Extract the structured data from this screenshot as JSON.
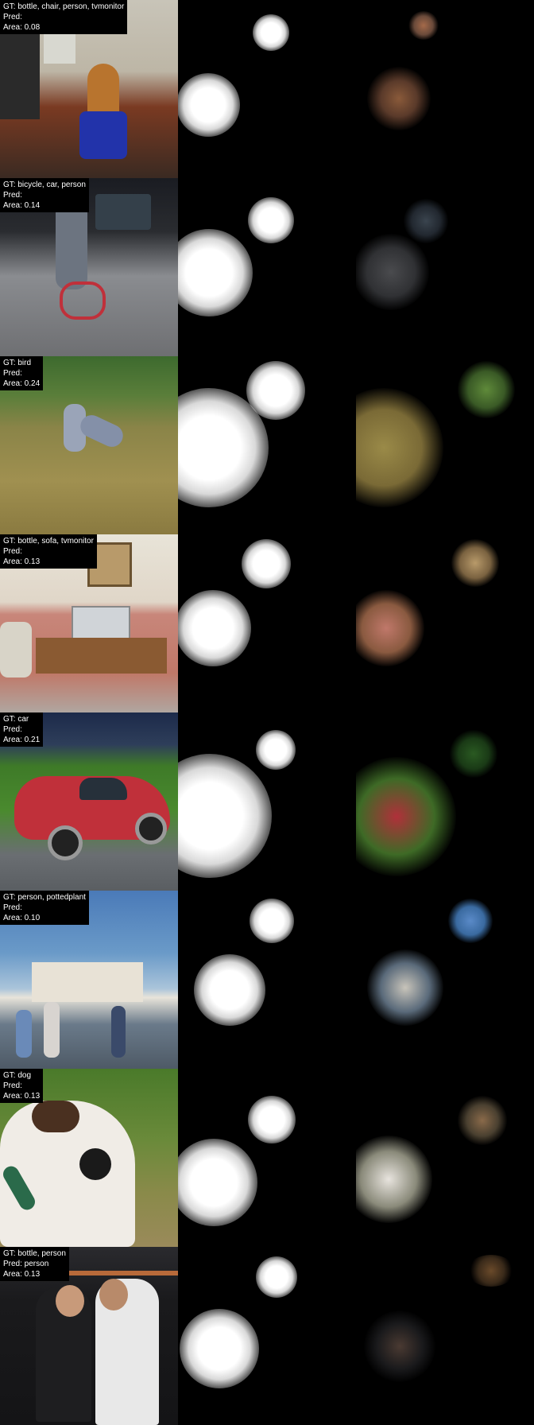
{
  "rows": [
    {
      "gt": "GT: bottle, chair, person, tvmonitor",
      "pred": "Pred:",
      "area": "Area: 0.08"
    },
    {
      "gt": "GT: bicycle, car, person",
      "pred": "Pred:",
      "area": "Area: 0.14"
    },
    {
      "gt": "GT: bird",
      "pred": "Pred:",
      "area": "Area: 0.24"
    },
    {
      "gt": "GT: bottle, sofa, tvmonitor",
      "pred": "Pred:",
      "area": "Area: 0.13"
    },
    {
      "gt": "GT: car",
      "pred": "Pred:",
      "area": "Area: 0.21"
    },
    {
      "gt": "GT: person, pottedplant",
      "pred": "Pred:",
      "area": "Area: 0.10"
    },
    {
      "gt": "GT: dog",
      "pred": "Pred:",
      "area": "Area: 0.13"
    },
    {
      "gt": "GT: bottle, person",
      "pred": "Pred: person",
      "area": "Area: 0.13"
    }
  ]
}
